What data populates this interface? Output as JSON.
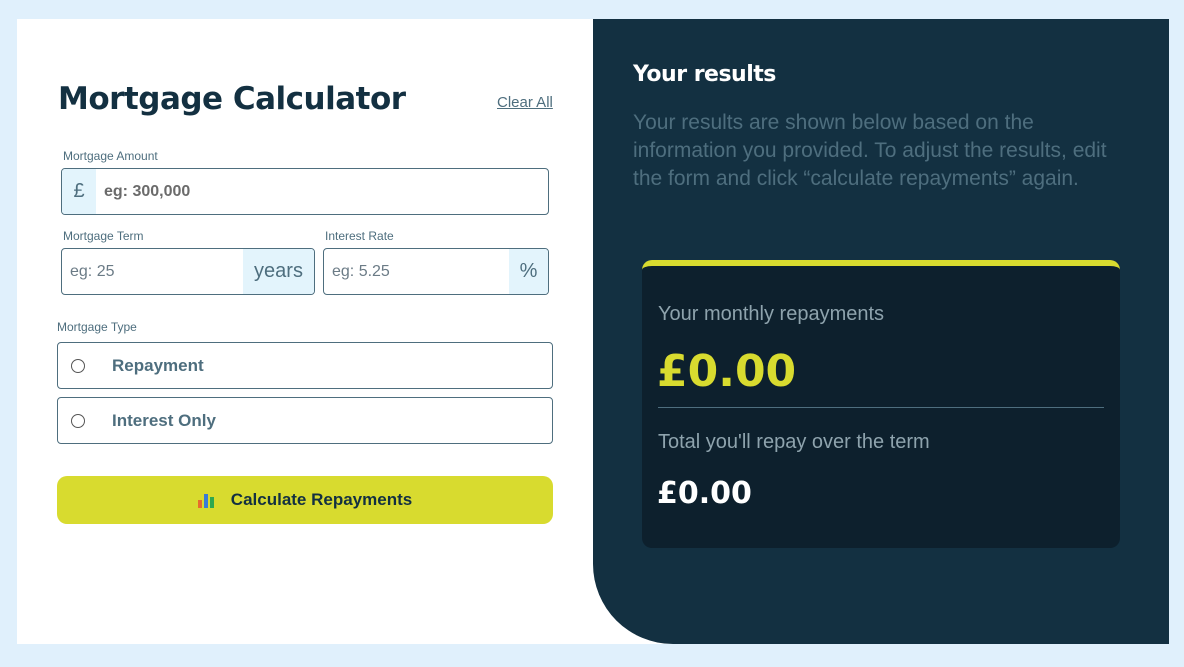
{
  "calculator": {
    "title": "Mortgage Calculator",
    "clear_label": "Clear All",
    "amount": {
      "label": "Mortgage Amount",
      "prefix": "£",
      "placeholder": "eg: 300,000"
    },
    "term": {
      "label": "Mortgage Term",
      "suffix": "years",
      "placeholder": "eg: 25"
    },
    "rate": {
      "label": "Interest Rate",
      "suffix": "%",
      "placeholder": "eg: 5.25"
    },
    "type": {
      "label": "Mortgage Type",
      "options": [
        "Repayment",
        "Interest Only"
      ]
    },
    "calculate_label": "Calculate Repayments",
    "calculate_icon": "bar-chart-icon"
  },
  "results": {
    "title": "Your results",
    "description": "Your results are shown below based on the information you provided. To adjust the results, edit the form and click “calculate repayments” again.",
    "monthly_label": "Your monthly repayments",
    "monthly_value": "£0.00",
    "total_label": "Total you'll repay over the term",
    "total_value": "£0.00"
  },
  "colors": {
    "accent": "#d8db2f",
    "dark": "#133041",
    "darker": "#0d202d",
    "muted": "#4e6e7e",
    "background": "#e0f0fc"
  }
}
